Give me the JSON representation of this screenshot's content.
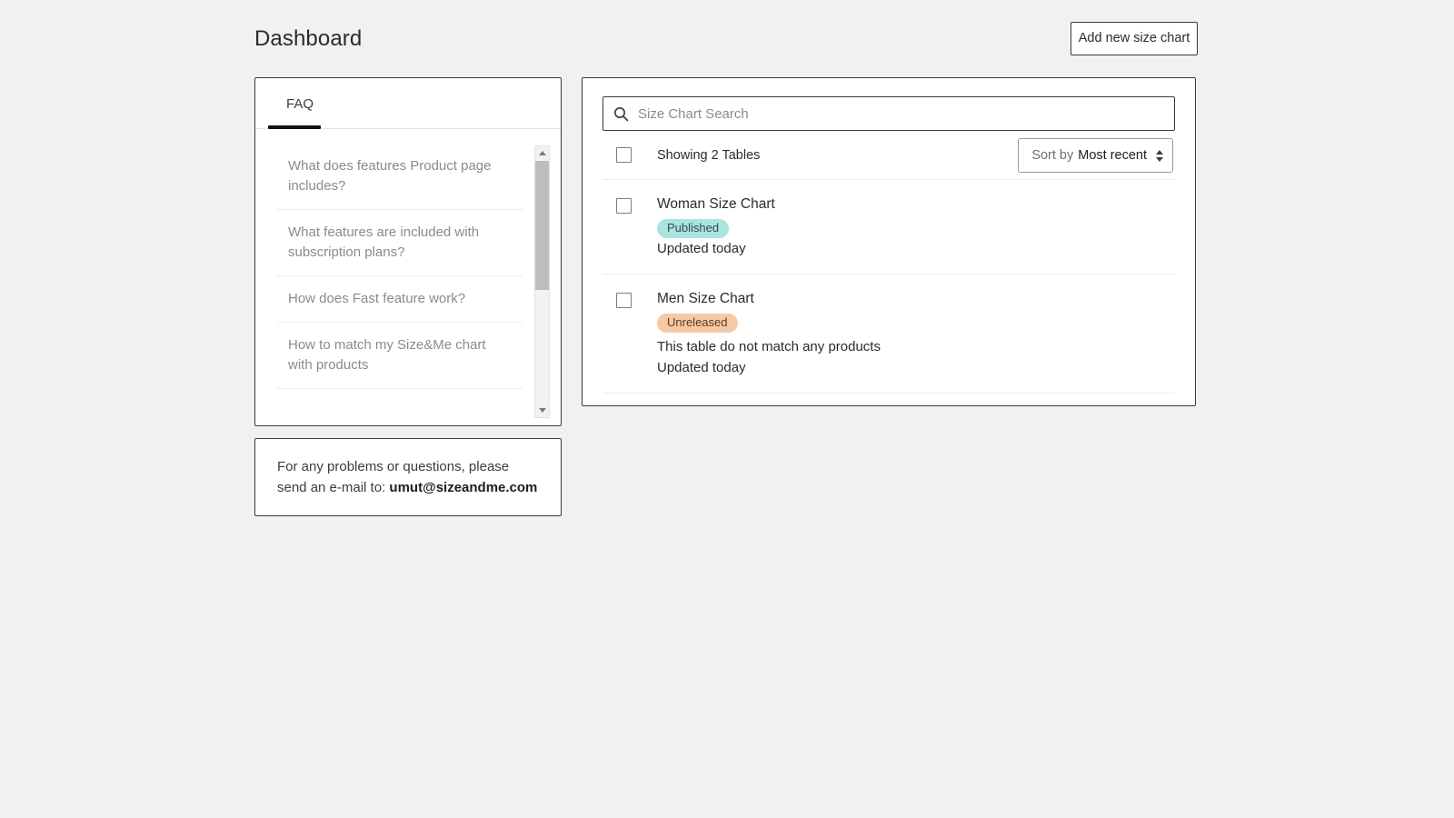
{
  "header": {
    "title": "Dashboard",
    "add_button_label": "Add new size chart"
  },
  "faq_panel": {
    "tab_label": "FAQ",
    "items": [
      {
        "question": "What does features Product page includes?"
      },
      {
        "question": "What features are included with subscription plans?"
      },
      {
        "question": "How does Fast feature work?"
      },
      {
        "question": "How to match my Size&Me chart with products"
      }
    ],
    "scrollbar": {
      "up_icon": "triangle-up-icon",
      "down_icon": "triangle-down-icon"
    }
  },
  "contact_card": {
    "text_before": "For any problems or questions, please send an e-mail to: ",
    "email": "umut@sizeandme.com"
  },
  "charts_panel": {
    "search": {
      "icon": "search-icon",
      "placeholder": "Size Chart Search",
      "value": ""
    },
    "toolbar": {
      "select_all_checkbox": "",
      "showing_label": "Showing 2 Tables",
      "sort": {
        "prefix": "Sort by",
        "value": "Most recent",
        "icon": "chevron-updown-icon"
      }
    },
    "rows": [
      {
        "title": "Woman Size Chart",
        "badge": "Published",
        "badge_bg": "#a9e4e1",
        "badge_color": "#2f4f4d",
        "note": "",
        "updated": "Updated today"
      },
      {
        "title": "Men Size Chart",
        "badge": "Unreleased",
        "badge_bg": "#f6c9a6",
        "badge_color": "#5a3a20",
        "note": "This table do not match any products",
        "updated": "Updated today"
      }
    ]
  }
}
